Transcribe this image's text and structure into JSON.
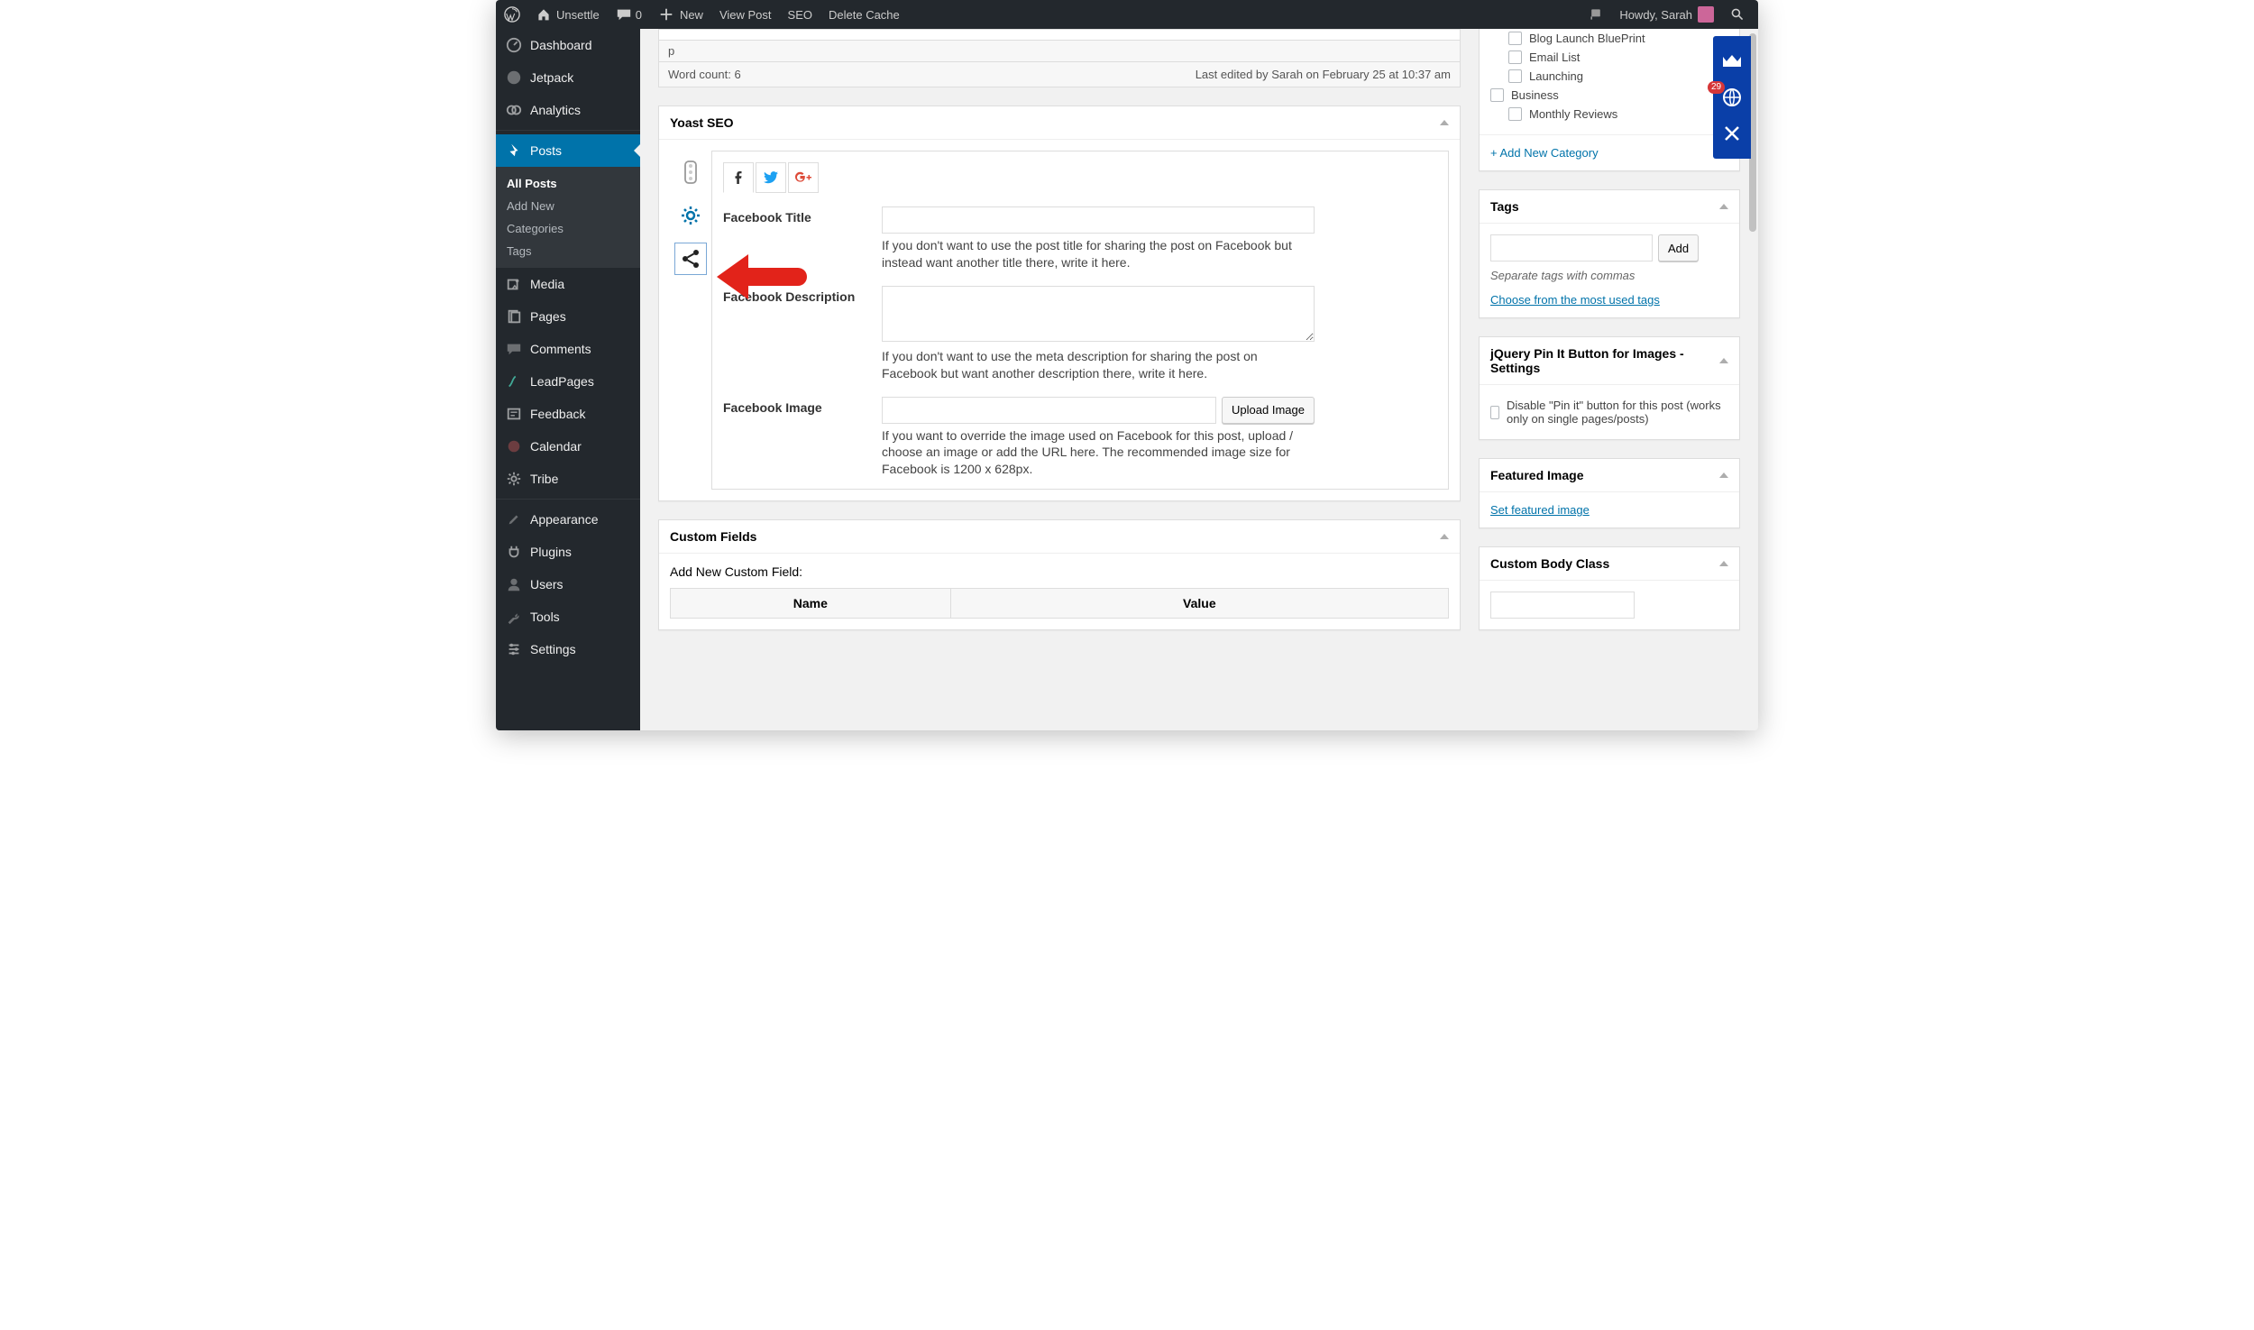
{
  "adminbar": {
    "site_name": "Unsettle",
    "comment_count": "0",
    "new_label": "New",
    "view_post_label": "View Post",
    "seo_label": "SEO",
    "delete_cache_label": "Delete Cache",
    "howdy": "Howdy, Sarah"
  },
  "sidebar": {
    "dashboard": "Dashboard",
    "jetpack": "Jetpack",
    "analytics": "Analytics",
    "posts": "Posts",
    "posts_sub": {
      "all": "All Posts",
      "add": "Add New",
      "cats": "Categories",
      "tags": "Tags"
    },
    "media": "Media",
    "pages": "Pages",
    "comments": "Comments",
    "leadpages": "LeadPages",
    "feedback": "Feedback",
    "calendar": "Calendar",
    "tribe": "Tribe",
    "appearance": "Appearance",
    "plugins": "Plugins",
    "users": "Users",
    "tools": "Tools",
    "settings": "Settings"
  },
  "editor_footer": {
    "path": "p",
    "word_count_label": "Word count: 6",
    "last_edited": "Last edited by Sarah on February 25 at 10:37 am"
  },
  "yoast": {
    "title": "Yoast SEO",
    "fb_title_label": "Facebook Title",
    "fb_title_hint": "If you don't want to use the post title for sharing the post on Facebook but instead want another title there, write it here.",
    "fb_desc_label": "Facebook Description",
    "fb_desc_hint": "If you don't want to use the meta description for sharing the post on Facebook but want another description there, write it here.",
    "fb_image_label": "Facebook Image",
    "upload_button": "Upload Image",
    "fb_image_hint": "If you want to override the image used on Facebook for this post, upload / choose an image or add the URL here. The recommended image size for Facebook is 1200 x 628px."
  },
  "custom_fields": {
    "title": "Custom Fields",
    "add_new_label": "Add New Custom Field:",
    "name_header": "Name",
    "value_header": "Value"
  },
  "categories": {
    "items": [
      {
        "label": "Blog Launch BluePrint",
        "indent": true
      },
      {
        "label": "Email List",
        "indent": true
      },
      {
        "label": "Launching",
        "indent": true
      },
      {
        "label": "Business",
        "indent": false
      },
      {
        "label": "Monthly Reviews",
        "indent": true
      }
    ],
    "add_new": "+ Add New Category"
  },
  "tags": {
    "title": "Tags",
    "add_button": "Add",
    "separator_hint": "Separate tags with commas",
    "choose_link": "Choose from the most used tags"
  },
  "pinit": {
    "title": "jQuery Pin It Button for Images - Settings",
    "checkbox_label": "Disable \"Pin it\" button for this post (works only on single pages/posts)"
  },
  "featured": {
    "title": "Featured Image",
    "link": "Set featured image"
  },
  "body_class": {
    "title": "Custom Body Class"
  },
  "sumo": {
    "badge": "29"
  }
}
